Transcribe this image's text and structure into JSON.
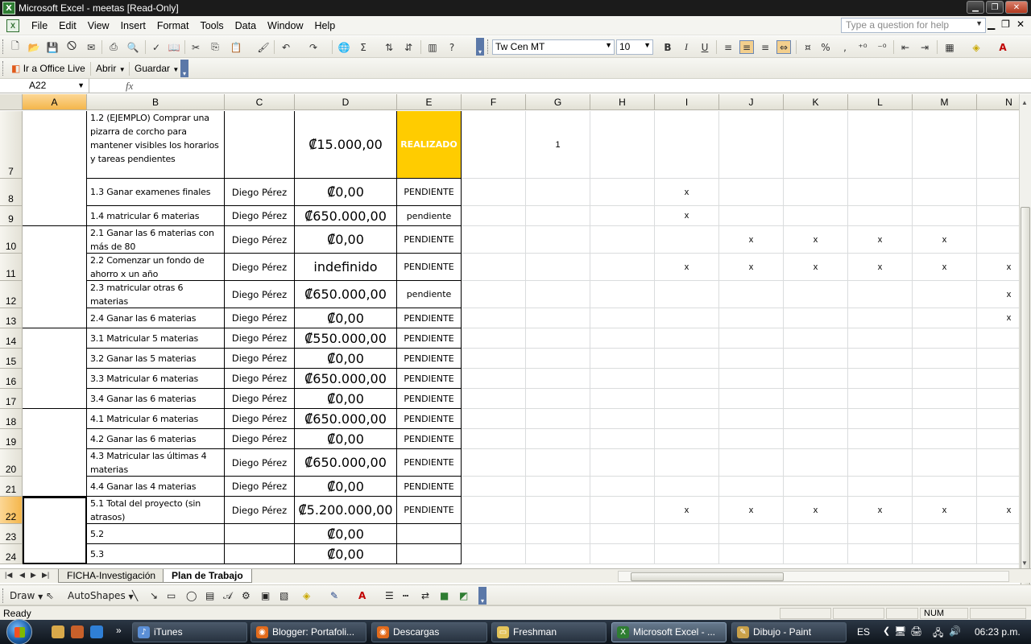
{
  "window": {
    "title": "Microsoft Excel - meetas  [Read-Only]"
  },
  "menu": {
    "items": [
      "File",
      "Edit",
      "View",
      "Insert",
      "Format",
      "Tools",
      "Data",
      "Window",
      "Help"
    ],
    "help_placeholder": "Type a question for help"
  },
  "toolbar": {
    "font_name": "Tw Cen MT",
    "font_size": "10",
    "bold_label": "B",
    "italic_label": "I",
    "underline_label": "U",
    "percent_label": "%",
    "comma_label": ","
  },
  "office_live_bar": {
    "go_label": "Ir a Office Live",
    "open_label": "Abrir",
    "save_label": "Guardar"
  },
  "formula_bar": {
    "name_box": "A22",
    "fx_label": "fx",
    "formula": ""
  },
  "columns": [
    "A",
    "B",
    "C",
    "D",
    "E",
    "F",
    "G",
    "H",
    "I",
    "J",
    "K",
    "L",
    "M",
    "N"
  ],
  "selected_column": "A",
  "rows": [
    {
      "num": "7",
      "b": "1.2 (EJEMPLO) Comprar una pizarra de corcho para mantener visibles los horarios y tareas pendientes",
      "c": "",
      "d": "₡15.000,00",
      "e": "REALIZADO",
      "g": "1",
      "marks": [
        "",
        "",
        "",
        "",
        "",
        ""
      ]
    },
    {
      "num": "8",
      "b": "1.3 Ganar examenes finales",
      "c": "Diego Pérez",
      "d": "₡0,00",
      "e": "PENDIENTE",
      "g": "",
      "marks": [
        "x",
        "",
        "",
        "",
        "",
        ""
      ]
    },
    {
      "num": "9",
      "b": "1.4 matricular 6 materias",
      "c": "Diego Pérez",
      "d": "₡650.000,00",
      "e": "pendiente",
      "g": "",
      "marks": [
        "x",
        "",
        "",
        "",
        "",
        ""
      ]
    },
    {
      "num": "10",
      "b": "2.1 Ganar las 6 materias con más de 80",
      "c": "Diego Pérez",
      "d": "₡0,00",
      "e": "PENDIENTE",
      "g": "",
      "marks": [
        "",
        "x",
        "x",
        "x",
        "x",
        ""
      ]
    },
    {
      "num": "11",
      "b": "2.2 Comenzar un fondo de ahorro x un año",
      "c": "Diego Pérez",
      "d": "indefinido",
      "e": "PENDIENTE",
      "g": "",
      "marks": [
        "x",
        "x",
        "x",
        "x",
        "x",
        "x"
      ]
    },
    {
      "num": "12",
      "b": "2.3 matricular otras 6 materias",
      "c": "Diego Pérez",
      "d": "₡650.000,00",
      "e": "pendiente",
      "g": "",
      "marks": [
        "",
        "",
        "",
        "",
        "",
        "x"
      ]
    },
    {
      "num": "13",
      "b": "2.4 Ganar las 6 materias",
      "c": "Diego Pérez",
      "d": "₡0,00",
      "e": "PENDIENTE",
      "g": "",
      "marks": [
        "",
        "",
        "",
        "",
        "",
        "x"
      ]
    },
    {
      "num": "14",
      "b": "3.1 Matricular 5 materias",
      "c": "Diego Pérez",
      "d": "₡550.000,00",
      "e": "PENDIENTE",
      "g": "",
      "marks": [
        "",
        "",
        "",
        "",
        "",
        ""
      ]
    },
    {
      "num": "15",
      "b": "3.2 Ganar las 5 materias",
      "c": "Diego Pérez",
      "d": "₡0,00",
      "e": "PENDIENTE",
      "g": "",
      "marks": [
        "",
        "",
        "",
        "",
        "",
        ""
      ]
    },
    {
      "num": "16",
      "b": "3.3 Matricular 6 materias",
      "c": "Diego Pérez",
      "d": "₡650.000,00",
      "e": "PENDIENTE",
      "g": "",
      "marks": [
        "",
        "",
        "",
        "",
        "",
        ""
      ]
    },
    {
      "num": "17",
      "b": "3.4 Ganar las 6 materias",
      "c": "Diego Pérez",
      "d": "₡0,00",
      "e": "PENDIENTE",
      "g": "",
      "marks": [
        "",
        "",
        "",
        "",
        "",
        ""
      ]
    },
    {
      "num": "18",
      "b": "4.1 Matricular 6 materias",
      "c": "Diego Pérez",
      "d": "₡650.000,00",
      "e": "PENDIENTE",
      "g": "",
      "marks": [
        "",
        "",
        "",
        "",
        "",
        ""
      ]
    },
    {
      "num": "19",
      "b": "4.2 Ganar las 6 materias",
      "c": "Diego Pérez",
      "d": "₡0,00",
      "e": "PENDIENTE",
      "g": "",
      "marks": [
        "",
        "",
        "",
        "",
        "",
        ""
      ]
    },
    {
      "num": "20",
      "b": "4.3 Matricular las últimas 4 materias",
      "c": "Diego Pérez",
      "d": "₡650.000,00",
      "e": "PENDIENTE",
      "g": "",
      "marks": [
        "",
        "",
        "",
        "",
        "",
        ""
      ]
    },
    {
      "num": "21",
      "b": "4.4 Ganar las 4 materias",
      "c": "Diego Pérez",
      "d": "₡0,00",
      "e": "PENDIENTE",
      "g": "",
      "marks": [
        "",
        "",
        "",
        "",
        "",
        ""
      ]
    },
    {
      "num": "22",
      "b": "5.1 Total del proyecto (sin atrasos)",
      "c": "Diego Pérez",
      "d": "₡5.200.000,00",
      "e": "PENDIENTE",
      "g": "",
      "marks": [
        "x",
        "x",
        "x",
        "x",
        "x",
        "x"
      ]
    },
    {
      "num": "23",
      "b": "5.2",
      "c": "",
      "d": "₡0,00",
      "e": "",
      "g": "",
      "marks": [
        "",
        "",
        "",
        "",
        "",
        ""
      ]
    },
    {
      "num": "24",
      "b": "5.3",
      "c": "",
      "d": "₡0,00",
      "e": "",
      "g": "",
      "marks": [
        "",
        "",
        "",
        "",
        "",
        ""
      ]
    }
  ],
  "selected_row": "22",
  "colors": {
    "realizado_fill": "#ffcc00",
    "selection_header": "#f4b64b"
  },
  "sheet_tabs": [
    "FICHA-Investigación",
    "Plan de Trabajo"
  ],
  "active_sheet": "Plan de Trabajo",
  "drawing_toolbar": {
    "draw_label": "Draw",
    "autoshapes_label": "AutoShapes"
  },
  "status": {
    "ready": "Ready",
    "num": "NUM"
  },
  "taskbar": {
    "tasks": [
      "iTunes",
      "Blogger: Portafoli...",
      "Descargas",
      "Freshman",
      "Microsoft Excel - ...",
      "Dibujo - Paint"
    ],
    "active_task": "Microsoft Excel - ...",
    "language": "ES",
    "clock": "06:23 p.m."
  }
}
